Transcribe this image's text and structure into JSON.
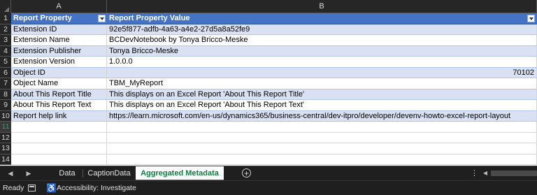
{
  "columns": [
    "A",
    "B"
  ],
  "rows": [
    {
      "num": "1",
      "a": "Report Property",
      "b": "Report Property Value",
      "style": "head"
    },
    {
      "num": "2",
      "a": "Extension ID",
      "b": "92e5f877-adfb-4a63-a4e2-27d5a8a52fe9",
      "style": "band"
    },
    {
      "num": "3",
      "a": "Extension Name",
      "b": "BCDevNotebook by Tonya Bricco-Meske",
      "style": "plain"
    },
    {
      "num": "4",
      "a": "Extension Publisher",
      "b": "Tonya Bricco-Meske",
      "style": "band"
    },
    {
      "num": "5",
      "a": "Extension Version",
      "b": "1.0.0.0",
      "style": "plain"
    },
    {
      "num": "6",
      "a": "Object ID",
      "b": "70102",
      "style": "band",
      "numeric": true
    },
    {
      "num": "7",
      "a": "Object Name",
      "b": "TBM_MyReport",
      "style": "plain"
    },
    {
      "num": "8",
      "a": "About This Report Title",
      "b": "This displays on an Excel Report 'About This Report Title'",
      "style": "band"
    },
    {
      "num": "9",
      "a": "About This Report Text",
      "b": "This displays on an Excel Report 'About This Report Text'",
      "style": "plain"
    },
    {
      "num": "10",
      "a": "Report help link",
      "b": "https://learn.microsoft.com/en-us/dynamics365/business-central/dev-itpro/developer/devenv-howto-excel-report-layout",
      "style": "band"
    },
    {
      "num": "11",
      "a": "",
      "b": "",
      "style": "empty",
      "selected": true
    },
    {
      "num": "12",
      "a": "",
      "b": "",
      "style": "empty"
    },
    {
      "num": "13",
      "a": "",
      "b": "",
      "style": "empty"
    },
    {
      "num": "14",
      "a": "",
      "b": "",
      "style": "empty"
    }
  ],
  "sheet_tabs": [
    {
      "label": "Data",
      "active": false
    },
    {
      "label": "CaptionData",
      "active": false
    },
    {
      "label": "Aggregated Metadata",
      "active": true
    }
  ],
  "status": {
    "ready": "Ready",
    "accessibility": "Accessibility: Investigate"
  },
  "icons": {
    "add_sheet": "plus-circle-icon",
    "prev_sheet": "triangle-left-icon",
    "next_sheet": "triangle-right-icon",
    "filter": "filter-dropdown-icon",
    "macro": "macro-recorder-icon",
    "accessibility": "accessibility-icon"
  },
  "colors": {
    "table_header": "#4472c4",
    "band": "#d9e1f2",
    "active_tab_text": "#107c41"
  }
}
